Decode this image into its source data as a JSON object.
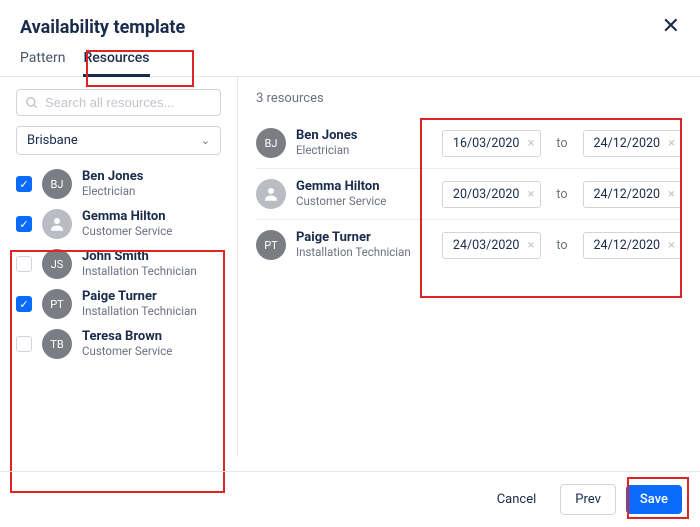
{
  "header": {
    "title": "Availability template"
  },
  "tabs": {
    "pattern": "Pattern",
    "resources": "Resources",
    "active": "resources"
  },
  "sidebar": {
    "search_placeholder": "Search all resources...",
    "location": "Brisbane",
    "resources": [
      {
        "name": "Ben Jones",
        "role": "Electrician",
        "initials": "BJ",
        "checked": true,
        "avatar_style": "dark"
      },
      {
        "name": "Gemma Hilton",
        "role": "Customer Service",
        "initials": "",
        "checked": true,
        "avatar_style": "person-light"
      },
      {
        "name": "John Smith",
        "role": "Installation Technician",
        "initials": "JS",
        "checked": false,
        "avatar_style": "dark"
      },
      {
        "name": "Paige Turner",
        "role": "Installation Technician",
        "initials": "PT",
        "checked": true,
        "avatar_style": "dark"
      },
      {
        "name": "Teresa Brown",
        "role": "Customer Service",
        "initials": "TB",
        "checked": false,
        "avatar_style": "dark"
      }
    ]
  },
  "main": {
    "count_label": "3 resources",
    "to_label": "to",
    "assigned": [
      {
        "name": "Ben Jones",
        "role": "Electrician",
        "initials": "BJ",
        "avatar_style": "dark",
        "start": "16/03/2020",
        "end": "24/12/2020"
      },
      {
        "name": "Gemma Hilton",
        "role": "Customer Service",
        "initials": "",
        "avatar_style": "person-light",
        "start": "20/03/2020",
        "end": "24/12/2020"
      },
      {
        "name": "Paige Turner",
        "role": "Installation Technician",
        "initials": "PT",
        "avatar_style": "dark",
        "start": "24/03/2020",
        "end": "24/12/2020"
      }
    ]
  },
  "footer": {
    "cancel": "Cancel",
    "prev": "Prev",
    "save": "Save"
  }
}
